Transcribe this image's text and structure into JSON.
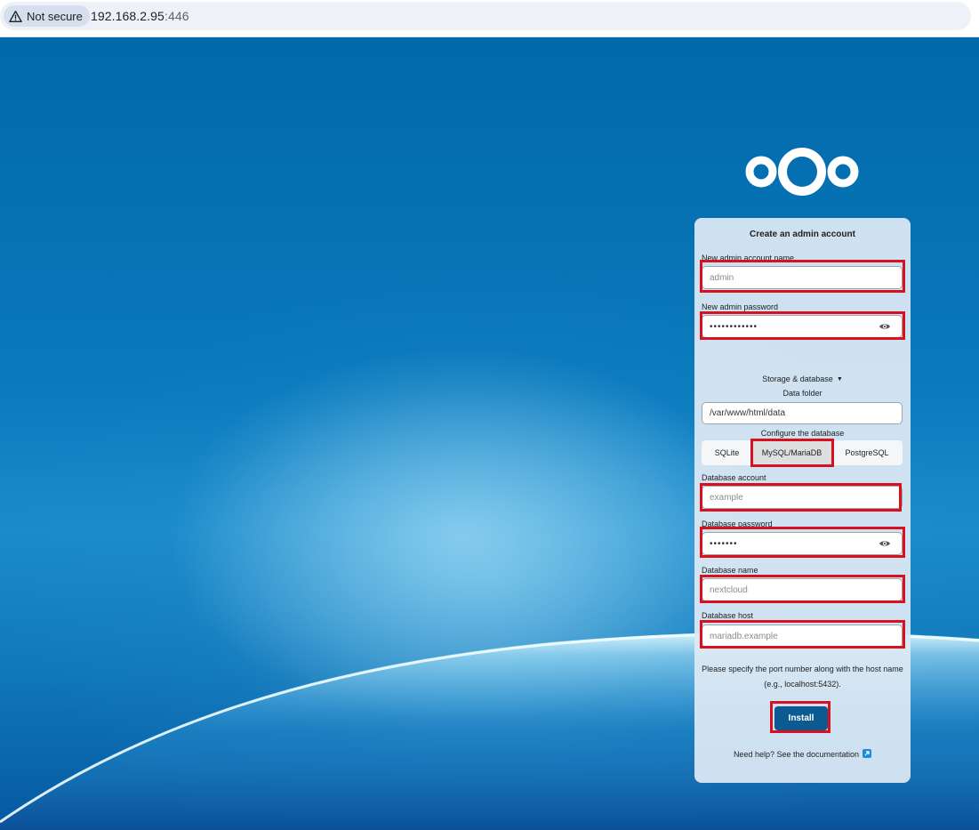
{
  "browser": {
    "security_chip": "Not secure",
    "url_host": "192.168.2.95",
    "url_port": ":446"
  },
  "setup": {
    "title": "Create an admin account",
    "admin_name_label": "New admin account name",
    "admin_name_placeholder": "admin",
    "admin_password_label": "New admin password",
    "admin_password_value": "••••••••••••",
    "storage_toggle": "Storage & database",
    "data_folder_label": "Data folder",
    "data_folder_value": "/var/www/html/data",
    "configure_db_label": "Configure the database",
    "db_options": [
      "SQLite",
      "MySQL/MariaDB",
      "PostgreSQL"
    ],
    "db_selected": "MySQL/MariaDB",
    "db_account_label": "Database account",
    "db_account_placeholder": "example",
    "db_password_label": "Database password",
    "db_password_value": "•••••••",
    "db_name_label": "Database name",
    "db_name_placeholder": "nextcloud",
    "db_host_label": "Database host",
    "db_host_placeholder": "mariadb.example",
    "port_hint": "Please specify the port number along with the host name (e.g., localhost:5432).",
    "install_label": "Install",
    "help_link": "Need help? See the documentation"
  },
  "colors": {
    "highlight": "#d9111f",
    "install_button": "#0b5b92",
    "link_icon": "#1c8fd8"
  },
  "icons": [
    "warning-icon",
    "nextcloud-logo",
    "eye-icon",
    "caret-down-icon",
    "external-link-icon"
  ]
}
